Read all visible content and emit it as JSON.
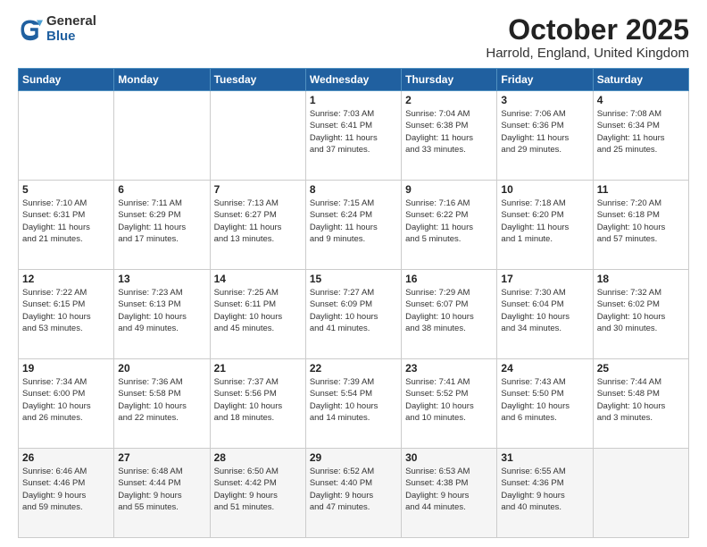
{
  "logo": {
    "general": "General",
    "blue": "Blue"
  },
  "title": "October 2025",
  "subtitle": "Harrold, England, United Kingdom",
  "days_of_week": [
    "Sunday",
    "Monday",
    "Tuesday",
    "Wednesday",
    "Thursday",
    "Friday",
    "Saturday"
  ],
  "weeks": [
    [
      {
        "day": "",
        "info": ""
      },
      {
        "day": "",
        "info": ""
      },
      {
        "day": "",
        "info": ""
      },
      {
        "day": "1",
        "info": "Sunrise: 7:03 AM\nSunset: 6:41 PM\nDaylight: 11 hours\nand 37 minutes."
      },
      {
        "day": "2",
        "info": "Sunrise: 7:04 AM\nSunset: 6:38 PM\nDaylight: 11 hours\nand 33 minutes."
      },
      {
        "day": "3",
        "info": "Sunrise: 7:06 AM\nSunset: 6:36 PM\nDaylight: 11 hours\nand 29 minutes."
      },
      {
        "day": "4",
        "info": "Sunrise: 7:08 AM\nSunset: 6:34 PM\nDaylight: 11 hours\nand 25 minutes."
      }
    ],
    [
      {
        "day": "5",
        "info": "Sunrise: 7:10 AM\nSunset: 6:31 PM\nDaylight: 11 hours\nand 21 minutes."
      },
      {
        "day": "6",
        "info": "Sunrise: 7:11 AM\nSunset: 6:29 PM\nDaylight: 11 hours\nand 17 minutes."
      },
      {
        "day": "7",
        "info": "Sunrise: 7:13 AM\nSunset: 6:27 PM\nDaylight: 11 hours\nand 13 minutes."
      },
      {
        "day": "8",
        "info": "Sunrise: 7:15 AM\nSunset: 6:24 PM\nDaylight: 11 hours\nand 9 minutes."
      },
      {
        "day": "9",
        "info": "Sunrise: 7:16 AM\nSunset: 6:22 PM\nDaylight: 11 hours\nand 5 minutes."
      },
      {
        "day": "10",
        "info": "Sunrise: 7:18 AM\nSunset: 6:20 PM\nDaylight: 11 hours\nand 1 minute."
      },
      {
        "day": "11",
        "info": "Sunrise: 7:20 AM\nSunset: 6:18 PM\nDaylight: 10 hours\nand 57 minutes."
      }
    ],
    [
      {
        "day": "12",
        "info": "Sunrise: 7:22 AM\nSunset: 6:15 PM\nDaylight: 10 hours\nand 53 minutes."
      },
      {
        "day": "13",
        "info": "Sunrise: 7:23 AM\nSunset: 6:13 PM\nDaylight: 10 hours\nand 49 minutes."
      },
      {
        "day": "14",
        "info": "Sunrise: 7:25 AM\nSunset: 6:11 PM\nDaylight: 10 hours\nand 45 minutes."
      },
      {
        "day": "15",
        "info": "Sunrise: 7:27 AM\nSunset: 6:09 PM\nDaylight: 10 hours\nand 41 minutes."
      },
      {
        "day": "16",
        "info": "Sunrise: 7:29 AM\nSunset: 6:07 PM\nDaylight: 10 hours\nand 38 minutes."
      },
      {
        "day": "17",
        "info": "Sunrise: 7:30 AM\nSunset: 6:04 PM\nDaylight: 10 hours\nand 34 minutes."
      },
      {
        "day": "18",
        "info": "Sunrise: 7:32 AM\nSunset: 6:02 PM\nDaylight: 10 hours\nand 30 minutes."
      }
    ],
    [
      {
        "day": "19",
        "info": "Sunrise: 7:34 AM\nSunset: 6:00 PM\nDaylight: 10 hours\nand 26 minutes."
      },
      {
        "day": "20",
        "info": "Sunrise: 7:36 AM\nSunset: 5:58 PM\nDaylight: 10 hours\nand 22 minutes."
      },
      {
        "day": "21",
        "info": "Sunrise: 7:37 AM\nSunset: 5:56 PM\nDaylight: 10 hours\nand 18 minutes."
      },
      {
        "day": "22",
        "info": "Sunrise: 7:39 AM\nSunset: 5:54 PM\nDaylight: 10 hours\nand 14 minutes."
      },
      {
        "day": "23",
        "info": "Sunrise: 7:41 AM\nSunset: 5:52 PM\nDaylight: 10 hours\nand 10 minutes."
      },
      {
        "day": "24",
        "info": "Sunrise: 7:43 AM\nSunset: 5:50 PM\nDaylight: 10 hours\nand 6 minutes."
      },
      {
        "day": "25",
        "info": "Sunrise: 7:44 AM\nSunset: 5:48 PM\nDaylight: 10 hours\nand 3 minutes."
      }
    ],
    [
      {
        "day": "26",
        "info": "Sunrise: 6:46 AM\nSunset: 4:46 PM\nDaylight: 9 hours\nand 59 minutes."
      },
      {
        "day": "27",
        "info": "Sunrise: 6:48 AM\nSunset: 4:44 PM\nDaylight: 9 hours\nand 55 minutes."
      },
      {
        "day": "28",
        "info": "Sunrise: 6:50 AM\nSunset: 4:42 PM\nDaylight: 9 hours\nand 51 minutes."
      },
      {
        "day": "29",
        "info": "Sunrise: 6:52 AM\nSunset: 4:40 PM\nDaylight: 9 hours\nand 47 minutes."
      },
      {
        "day": "30",
        "info": "Sunrise: 6:53 AM\nSunset: 4:38 PM\nDaylight: 9 hours\nand 44 minutes."
      },
      {
        "day": "31",
        "info": "Sunrise: 6:55 AM\nSunset: 4:36 PM\nDaylight: 9 hours\nand 40 minutes."
      },
      {
        "day": "",
        "info": ""
      }
    ]
  ]
}
